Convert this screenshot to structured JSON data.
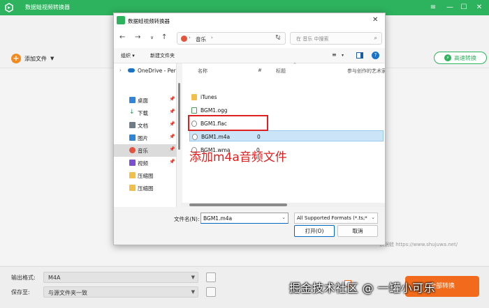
{
  "app": {
    "title": "数据蛙视频转换器",
    "window_controls": [
      "≡",
      "—",
      "☐",
      "✕"
    ]
  },
  "toolbar": {
    "add_file_label": "添加文件",
    "fast_convert_label": "高速转换"
  },
  "dialog": {
    "title": "数据蛙视频转换器",
    "address": {
      "location": "音乐",
      "separator": "›"
    },
    "search_placeholder": "在 音乐 中搜索",
    "commands": {
      "organize": "组织",
      "new_folder": "新建文件夹"
    },
    "nav": {
      "onedrive": "OneDrive - Per",
      "items": [
        {
          "label": "桌面",
          "icon": "desktop-icon",
          "color": "#2f86d8"
        },
        {
          "label": "下载",
          "icon": "download-icon",
          "color": "#1b9a5b"
        },
        {
          "label": "文档",
          "icon": "document-icon",
          "color": "#6f7b87"
        },
        {
          "label": "图片",
          "icon": "picture-icon",
          "color": "#2f86d8"
        },
        {
          "label": "音乐",
          "icon": "music-icon",
          "color": "#e2543d",
          "selected": true
        },
        {
          "label": "视频",
          "icon": "video-icon",
          "color": "#7a4fd1"
        },
        {
          "label": "压缩图",
          "icon": "folder-icon",
          "color": "#f1c04b"
        },
        {
          "label": "压缩图",
          "icon": "folder-icon",
          "color": "#f1c04b"
        }
      ]
    },
    "columns": {
      "name": "名称",
      "number": "#",
      "title": "标题",
      "artists": "参与创作的艺术家"
    },
    "files": [
      {
        "name": "iTunes",
        "number": "",
        "icon": "folder-icon"
      },
      {
        "name": "BGM1.ogg",
        "number": "",
        "icon": "audio-file-icon"
      },
      {
        "name": "BGM1.flac",
        "number": "",
        "icon": "audio-file-icon"
      },
      {
        "name": "BGM1.m4a",
        "number": "0",
        "icon": "audio-file-icon",
        "selected": true
      },
      {
        "name": "BGM1.wma",
        "number": "0",
        "icon": "audio-file-icon"
      }
    ],
    "annotation": "添加m4a音频文件",
    "footer": {
      "filename_label": "文件名(N):",
      "filename_value": "BGM1.m4a",
      "filter_value": "All Supported Formats (*.ts;*",
      "open_label": "打开(O)",
      "cancel_label": "取消"
    }
  },
  "watermark": "数据蛙   https://www.shujuwa.net/",
  "bottom": {
    "output_format_label": "输出格式:",
    "output_format_value": "M4A",
    "save_to_label": "保存至:",
    "save_to_value": "与源文件夹一致",
    "convert_label": "全部转换"
  },
  "overlay_text": "掘金技术社区 @ 一罐小可乐",
  "colors": {
    "brand_green": "#2db25e",
    "accent_orange": "#f28a21",
    "annotation_red": "#e02020"
  }
}
